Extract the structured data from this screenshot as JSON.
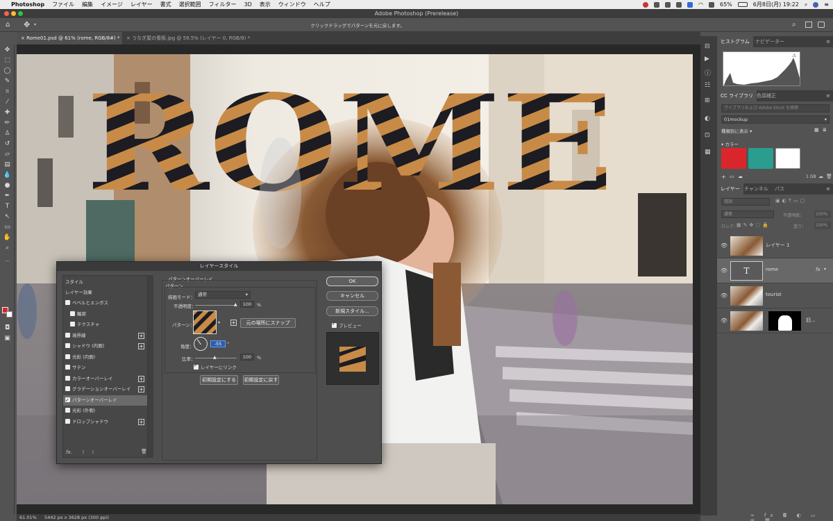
{
  "menubar": {
    "app": "Photoshop",
    "items": [
      "ファイル",
      "編集",
      "イメージ",
      "レイヤー",
      "書式",
      "選択範囲",
      "フィルター",
      "3D",
      "表示",
      "ウィンドウ",
      "ヘルプ"
    ],
    "battery": "65%",
    "datetime": "6月8日(月)  19:22"
  },
  "window": {
    "title": "Adobe Photoshop (Prerelease)"
  },
  "options_bar": {
    "hint": "クリックドラッグでパターンを元に戻します。"
  },
  "tabs": [
    {
      "label": "Rome01.psd @ 61% (rome, RGB/8#) *"
    },
    {
      "label": "うなぎ屋の看板.jpg @ 59.5% (レイヤー 0, RGB/8) *"
    }
  ],
  "canvas": {
    "headline": "ROME"
  },
  "status": {
    "zoom": "61.01%",
    "doc": "5442 px x 3628 px (300 ppi)"
  },
  "histogram_panel": {
    "tabs": [
      "ヒストグラム",
      "ナビゲーター"
    ]
  },
  "library_panel": {
    "tabs": [
      "CC ライブラリ",
      "色調補正"
    ],
    "search_placeholder": "ライブラリおよび Adobe Stock を検索",
    "library": "01mockup",
    "view_label": "種類別に表示",
    "colors_label": "カラー",
    "storage": "1 GB",
    "swatches": [
      "#d9262c",
      "#2a9d8f",
      "#ffffff"
    ]
  },
  "layers_panel": {
    "tabs": [
      "レイヤー",
      "チャンネル",
      "パス"
    ],
    "kind_placeholder": "種類",
    "blend": "通常",
    "opacity_label": "不透明度：",
    "opacity": "100%",
    "lock_label": "ロック：",
    "fill_label": "塗り：",
    "fill": "100%",
    "layers": [
      {
        "name": "レイヤー 1"
      },
      {
        "name": "rome",
        "fx": "fx"
      },
      {
        "name": "tourist"
      },
      {
        "name": "旧..."
      }
    ]
  },
  "dialog": {
    "title": "レイヤースタイル",
    "styles_header": "スタイル",
    "effects_header": "レイヤー効果",
    "effects": [
      {
        "label": "ベベルとエンボス",
        "checked": false,
        "plus": false,
        "sub": false
      },
      {
        "label": "輪郭",
        "checked": false,
        "plus": false,
        "sub": true
      },
      {
        "label": "テクスチャ",
        "checked": false,
        "plus": false,
        "sub": true
      },
      {
        "label": "境界線",
        "checked": false,
        "plus": true,
        "sub": false
      },
      {
        "label": "シャドウ (内側)",
        "checked": false,
        "plus": true,
        "sub": false
      },
      {
        "label": "光彩 (内側)",
        "checked": false,
        "plus": false,
        "sub": false
      },
      {
        "label": "サテン",
        "checked": false,
        "plus": false,
        "sub": false
      },
      {
        "label": "カラーオーバーレイ",
        "checked": false,
        "plus": true,
        "sub": false
      },
      {
        "label": "グラデーションオーバーレイ",
        "checked": false,
        "plus": true,
        "sub": false
      },
      {
        "label": "パターンオーバーレイ",
        "checked": true,
        "plus": false,
        "sub": false,
        "selected": true
      },
      {
        "label": "光彩 (外側)",
        "checked": false,
        "plus": false,
        "sub": false
      },
      {
        "label": "ドロップシャドウ",
        "checked": false,
        "plus": true,
        "sub": false
      }
    ],
    "section_title": "パターンオーバーレイ",
    "section_sub": "パターン",
    "blend_label": "描画モード：",
    "blend_value": "通常",
    "opacity_label": "不透明度：",
    "opacity_value": "100",
    "percent": "%",
    "pattern_label": "パターン：",
    "snap_button": "元の場所にスナップ",
    "angle_label": "角度：",
    "angle_value": "-55",
    "degree": "°",
    "scale_label": "比率：",
    "scale_value": "100",
    "link_label": "レイヤーにリンク",
    "reset_default": "初期設定にする",
    "restore_default": "初期設定に戻す",
    "ok": "OK",
    "cancel": "キャンセル",
    "new_style": "新規スタイル...",
    "preview": "プレビュー",
    "fx": "fx."
  }
}
